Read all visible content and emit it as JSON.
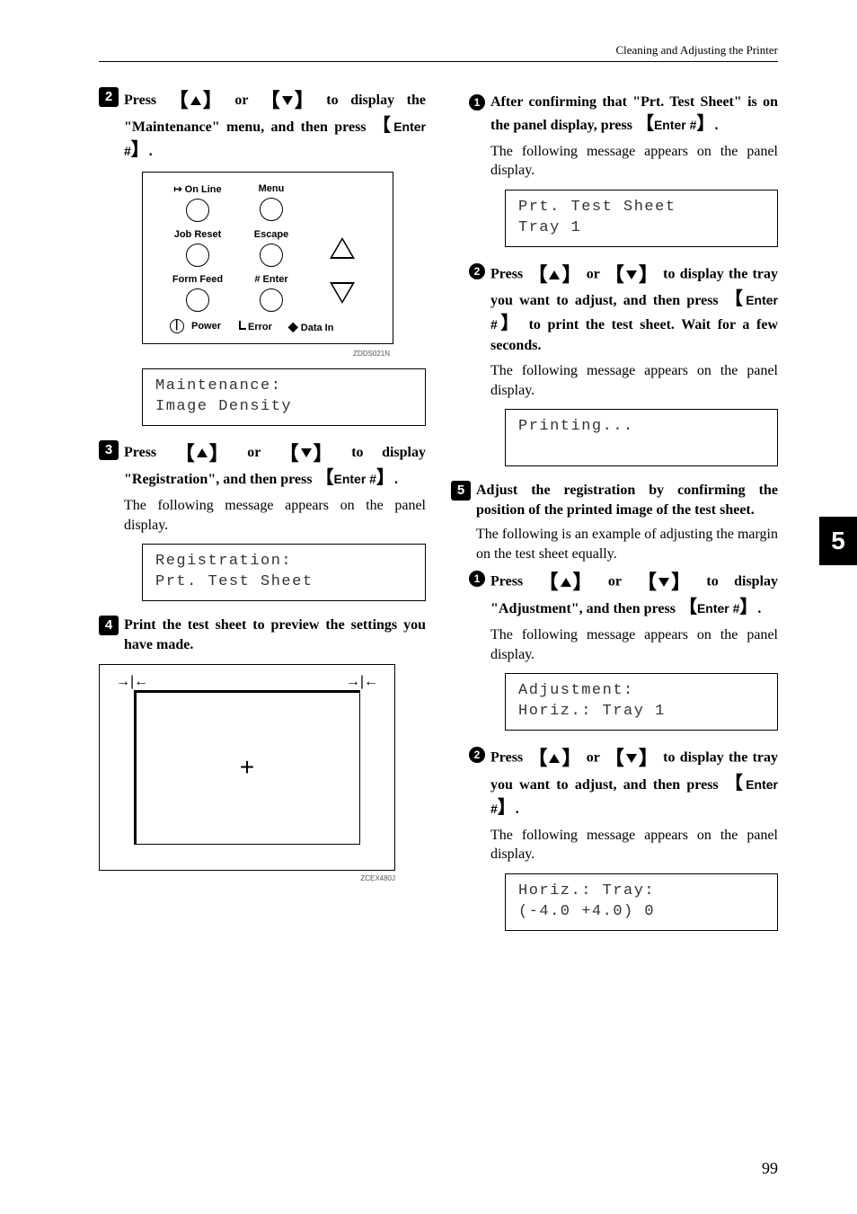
{
  "header": "Cleaning and Adjusting the Printer",
  "side_tab": "5",
  "page_number": "99",
  "panel": {
    "labels": {
      "online": "On Line",
      "menu": "Menu",
      "jobreset": "Job Reset",
      "escape": "Escape",
      "formfeed": "Form Feed",
      "enter": "Enter",
      "power": "Power",
      "error": "Error",
      "datain": "Data In"
    },
    "img_id": "ZDDS021N"
  },
  "testsheet_img_id": "ZCEX480J",
  "left": {
    "step2_pre": "Press ",
    "step2_mid": " or ",
    "step2_post": " to display the \"Maintenance\" menu, and then press ",
    "step2_key": "Enter #",
    "lcd1_line1": "Maintenance:",
    "lcd1_line2": " Image Density",
    "step3_pre": "Press ",
    "step3_mid": " or ",
    "step3_post": " to display \"Registration\", and then press ",
    "step3_key": "Enter #",
    "step3_body": "The following message appears on the panel display.",
    "lcd2_line1": "Registration:",
    "lcd2_line2": " Prt. Test Sheet",
    "step4": "Print the test sheet to preview the settings you have made."
  },
  "right": {
    "sub1_pre": "After confirming that \"Prt. Test Sheet\" is on the panel display, press ",
    "sub1_key": "Enter #",
    "sub1_body": "The following message appears on the panel display.",
    "lcd3_line1": "Prt. Test Sheet",
    "lcd3_line2": " Tray 1",
    "sub2_pre": "Press ",
    "sub2_mid": " or ",
    "sub2_post1": " to display the tray you want to adjust, and then press ",
    "sub2_key": "Enter #",
    "sub2_post2": " to print the test sheet. Wait for a few seconds.",
    "sub2_body": "The following message appears on the panel display.",
    "lcd4_line1": "Printing...",
    "step5": "Adjust the registration by confirming the position of the printed image of the test sheet.",
    "step5_body": "The following is an example of adjusting the margin on the test sheet equally.",
    "sub5a_pre": "Press ",
    "sub5a_mid": " or ",
    "sub5a_post": " to display \"Adjustment\", and then press ",
    "sub5a_key": "Enter #",
    "sub5a_body": "The following message appears on the panel display.",
    "lcd5_line1": "Adjustment:",
    "lcd5_line2": " Horiz.: Tray 1",
    "sub5b_pre": "Press ",
    "sub5b_mid": " or ",
    "sub5b_post": " to display the tray you want to adjust, and then press ",
    "sub5b_key": "Enter #",
    "sub5b_body": "The following message appears on the panel display.",
    "lcd6_line1": "Horiz.: Tray:",
    "lcd6_line2": "(-4.0 +4.0)    0"
  }
}
